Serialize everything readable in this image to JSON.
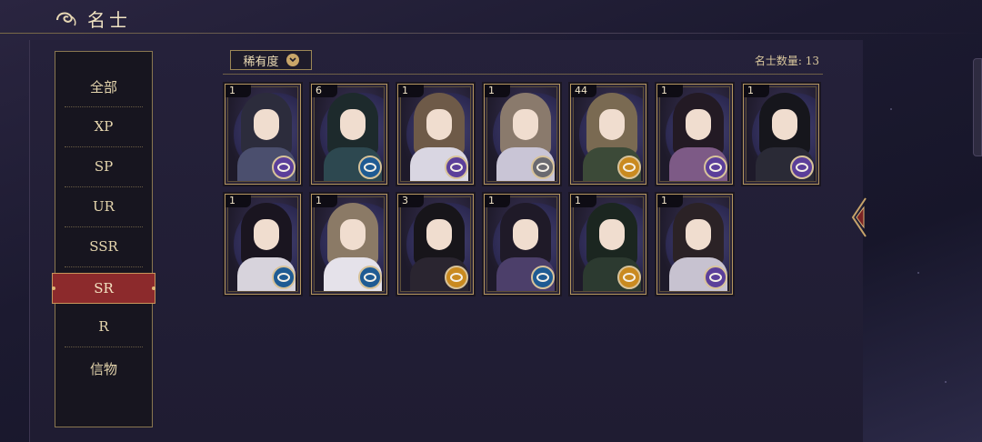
{
  "header": {
    "title": "名士"
  },
  "sidebar": {
    "items": [
      {
        "label": "全部"
      },
      {
        "label": "XP"
      },
      {
        "label": "SP"
      },
      {
        "label": "UR"
      },
      {
        "label": "SSR"
      },
      {
        "label": "SR",
        "active": true
      },
      {
        "label": "R"
      },
      {
        "label": "信物"
      }
    ]
  },
  "filter": {
    "label": "稀有度",
    "count_text": "名士数量: 13"
  },
  "cards": [
    {
      "level": "1",
      "badge": "purple",
      "hair": "#2c2c3c",
      "robe": "#4b4f6e"
    },
    {
      "level": "6",
      "badge": "blue",
      "hair": "#1d2a2c",
      "robe": "#2d4850"
    },
    {
      "level": "1",
      "badge": "purple",
      "hair": "#6e5a48",
      "robe": "#d9d6e2"
    },
    {
      "level": "1",
      "badge": "gray",
      "hair": "#8a7a6c",
      "robe": "#c9c5d6"
    },
    {
      "level": "44",
      "badge": "gold",
      "hair": "#7a6a52",
      "robe": "#3c4a38"
    },
    {
      "level": "1",
      "badge": "purple",
      "hair": "#231a24",
      "robe": "#7d5a86"
    },
    {
      "level": "1",
      "badge": "purple",
      "hair": "#16161c",
      "robe": "#2a2a36"
    },
    {
      "level": "1",
      "badge": "blue",
      "hair": "#1a1520",
      "robe": "#d7d3dc"
    },
    {
      "level": "1",
      "badge": "blue",
      "hair": "#8b7a66",
      "robe": "#e5e2ea"
    },
    {
      "level": "3",
      "badge": "gold",
      "hair": "#17151a",
      "robe": "#2a2530"
    },
    {
      "level": "1",
      "badge": "blue",
      "hair": "#1f1a28",
      "robe": "#4c3f6a"
    },
    {
      "level": "1",
      "badge": "gold",
      "hair": "#1b2620",
      "robe": "#2c3a30"
    },
    {
      "level": "1",
      "badge": "purple",
      "hair": "#2b2226",
      "robe": "#c7c2d0"
    }
  ],
  "badge_colors": {
    "purple": "#5b3f9a",
    "blue": "#1f5b93",
    "gold": "#c98a20",
    "gray": "#6a6a70"
  },
  "colors": {
    "accent_red": "#8c2a2c",
    "gold_border": "#b59660"
  }
}
